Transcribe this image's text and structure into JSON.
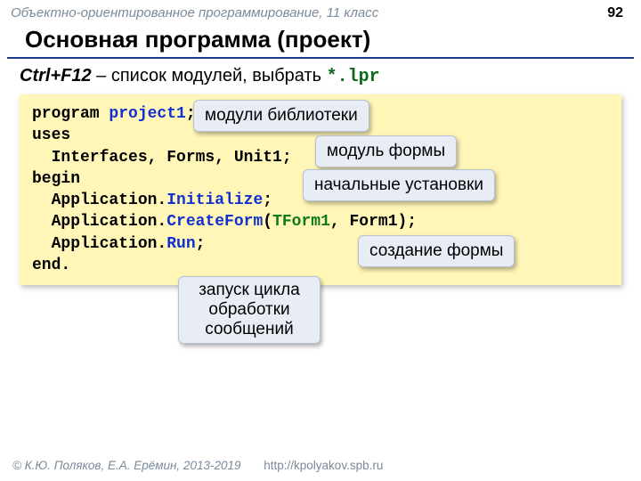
{
  "header": {
    "course": "Объектно-ориентированное программирование, 11 класс",
    "page": "92"
  },
  "title": "Основная программа (проект)",
  "subtitle": {
    "hotkey": "Ctrl+F12",
    "text": " – список модулей, выбрать ",
    "ext": "*.lpr"
  },
  "code": {
    "l1a": "program ",
    "l1b": "project1",
    "l1c": ";",
    "l2": "uses",
    "l3": "  Interfaces, Forms, Unit1;",
    "l4": "begin",
    "l5a": "  Application.",
    "l5b": "Initialize",
    "l5c": ";",
    "l6a": "  Application.",
    "l6b": "CreateForm",
    "l6c": "(",
    "l6d": "TForm1",
    "l6e": ", Form1);",
    "l7a": "  Application.",
    "l7b": "Run",
    "l7c": ";",
    "l8": "end."
  },
  "callouts": {
    "c1": "модули библиотеки",
    "c2": "модуль формы",
    "c3": "начальные установки",
    "c4": "создание формы",
    "c5": "запуск цикла обработки сообщений"
  },
  "footer": {
    "copyright": "© К.Ю. Поляков, Е.А. Ерёмин, 2013-2019",
    "url": "http://kpolyakov.spb.ru"
  }
}
